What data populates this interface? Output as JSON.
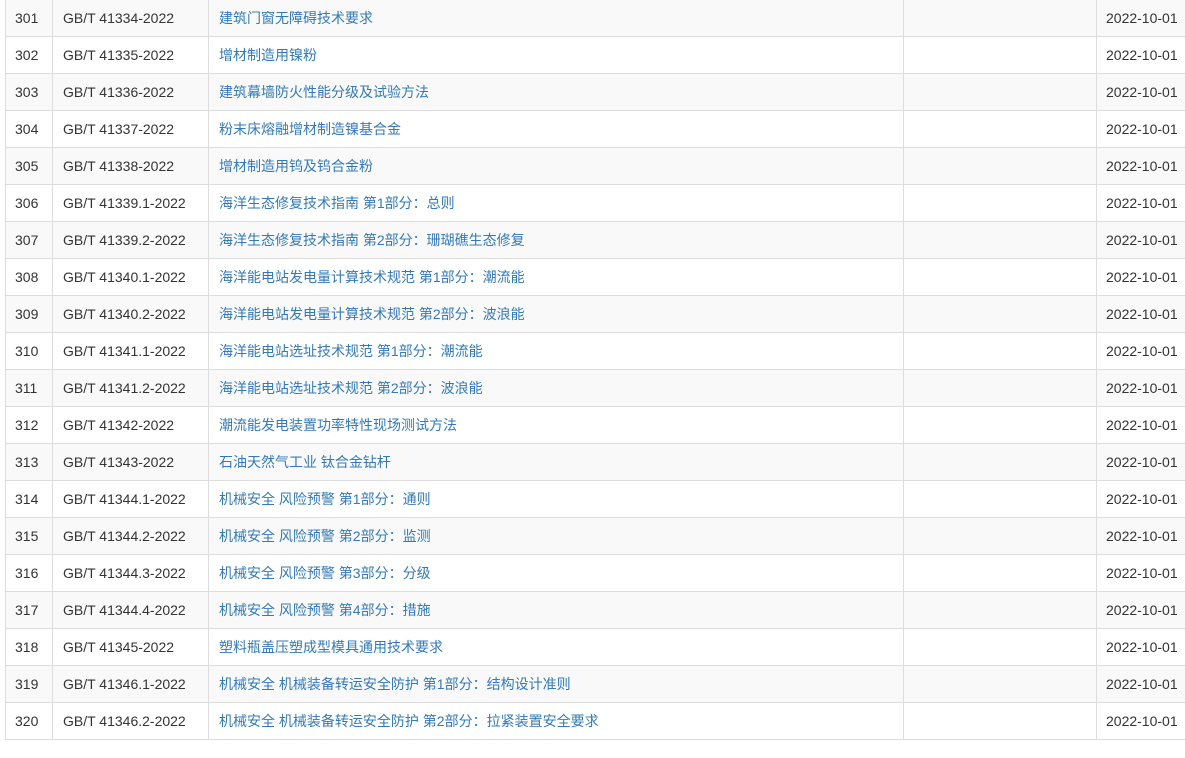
{
  "colors": {
    "link": "#337ab7",
    "text": "#333333",
    "border": "#dddddd",
    "stripe": "#f9f9f9"
  },
  "rows": [
    {
      "num": "301",
      "code": "GB/T 41334-2022",
      "title": "建筑门窗无障碍技术要求",
      "blank": "",
      "date": "2022-10-01"
    },
    {
      "num": "302",
      "code": "GB/T 41335-2022",
      "title": "增材制造用镍粉",
      "blank": "",
      "date": "2022-10-01"
    },
    {
      "num": "303",
      "code": "GB/T 41336-2022",
      "title": "建筑幕墙防火性能分级及试验方法",
      "blank": "",
      "date": "2022-10-01"
    },
    {
      "num": "304",
      "code": "GB/T 41337-2022",
      "title": "粉末床熔融增材制造镍基合金",
      "blank": "",
      "date": "2022-10-01"
    },
    {
      "num": "305",
      "code": "GB/T 41338-2022",
      "title": "增材制造用钨及钨合金粉",
      "blank": "",
      "date": "2022-10-01"
    },
    {
      "num": "306",
      "code": "GB/T 41339.1-2022",
      "title": "海洋生态修复技术指南 第1部分：总则",
      "blank": "",
      "date": "2022-10-01"
    },
    {
      "num": "307",
      "code": "GB/T 41339.2-2022",
      "title": "海洋生态修复技术指南 第2部分：珊瑚礁生态修复",
      "blank": "",
      "date": "2022-10-01"
    },
    {
      "num": "308",
      "code": "GB/T 41340.1-2022",
      "title": "海洋能电站发电量计算技术规范 第1部分：潮流能",
      "blank": "",
      "date": "2022-10-01"
    },
    {
      "num": "309",
      "code": "GB/T 41340.2-2022",
      "title": "海洋能电站发电量计算技术规范 第2部分：波浪能",
      "blank": "",
      "date": "2022-10-01"
    },
    {
      "num": "310",
      "code": "GB/T 41341.1-2022",
      "title": "海洋能电站选址技术规范 第1部分：潮流能",
      "blank": "",
      "date": "2022-10-01"
    },
    {
      "num": "311",
      "code": "GB/T 41341.2-2022",
      "title": "海洋能电站选址技术规范 第2部分：波浪能",
      "blank": "",
      "date": "2022-10-01"
    },
    {
      "num": "312",
      "code": "GB/T 41342-2022",
      "title": "潮流能发电装置功率特性现场测试方法",
      "blank": "",
      "date": "2022-10-01"
    },
    {
      "num": "313",
      "code": "GB/T 41343-2022",
      "title": "石油天然气工业 钛合金钻杆",
      "blank": "",
      "date": "2022-10-01"
    },
    {
      "num": "314",
      "code": "GB/T 41344.1-2022",
      "title": "机械安全 风险预警 第1部分：通则",
      "blank": "",
      "date": "2022-10-01"
    },
    {
      "num": "315",
      "code": "GB/T 41344.2-2022",
      "title": "机械安全 风险预警 第2部分：监测",
      "blank": "",
      "date": "2022-10-01"
    },
    {
      "num": "316",
      "code": "GB/T 41344.3-2022",
      "title": "机械安全 风险预警 第3部分：分级",
      "blank": "",
      "date": "2022-10-01"
    },
    {
      "num": "317",
      "code": "GB/T 41344.4-2022",
      "title": "机械安全 风险预警 第4部分：措施",
      "blank": "",
      "date": "2022-10-01"
    },
    {
      "num": "318",
      "code": "GB/T 41345-2022",
      "title": "塑料瓶盖压塑成型模具通用技术要求",
      "blank": "",
      "date": "2022-10-01"
    },
    {
      "num": "319",
      "code": "GB/T 41346.1-2022",
      "title": "机械安全 机械装备转运安全防护 第1部分：结构设计准则",
      "blank": "",
      "date": "2022-10-01"
    },
    {
      "num": "320",
      "code": "GB/T 41346.2-2022",
      "title": "机械安全 机械装备转运安全防护 第2部分：拉紧装置安全要求",
      "blank": "",
      "date": "2022-10-01"
    }
  ]
}
